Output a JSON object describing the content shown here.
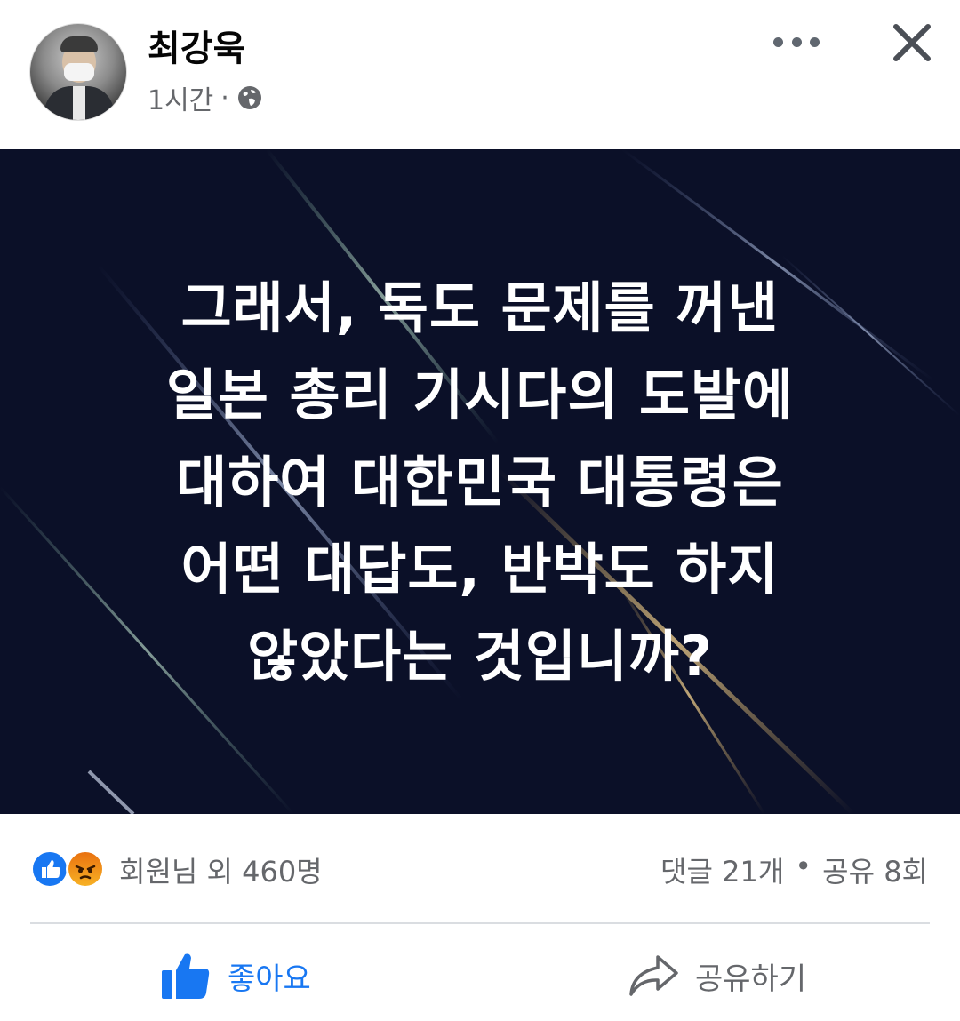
{
  "post": {
    "author": "최강욱",
    "time": "1시간",
    "separator": "·",
    "privacy_icon": "globe-icon",
    "image_text_lines": [
      "그래서, 독도 문제를 꺼낸",
      "일본 총리 기시다의 도발에",
      "대하여 대한민국 대통령은",
      "어떤 대답도, 반박도 하지",
      "않았다는 것입니까?"
    ],
    "image_background": "#0b1028"
  },
  "header": {
    "more_icon": "more-horizontal-icon",
    "close_icon": "close-icon"
  },
  "stats": {
    "reactions": "회원님 외 460명",
    "comments": "댓글 21개",
    "stats_separator": "•",
    "shares": "공유 8회"
  },
  "actions": {
    "like_label": "좋아요",
    "share_label": "공유하기",
    "like_color": "#1877f2"
  }
}
